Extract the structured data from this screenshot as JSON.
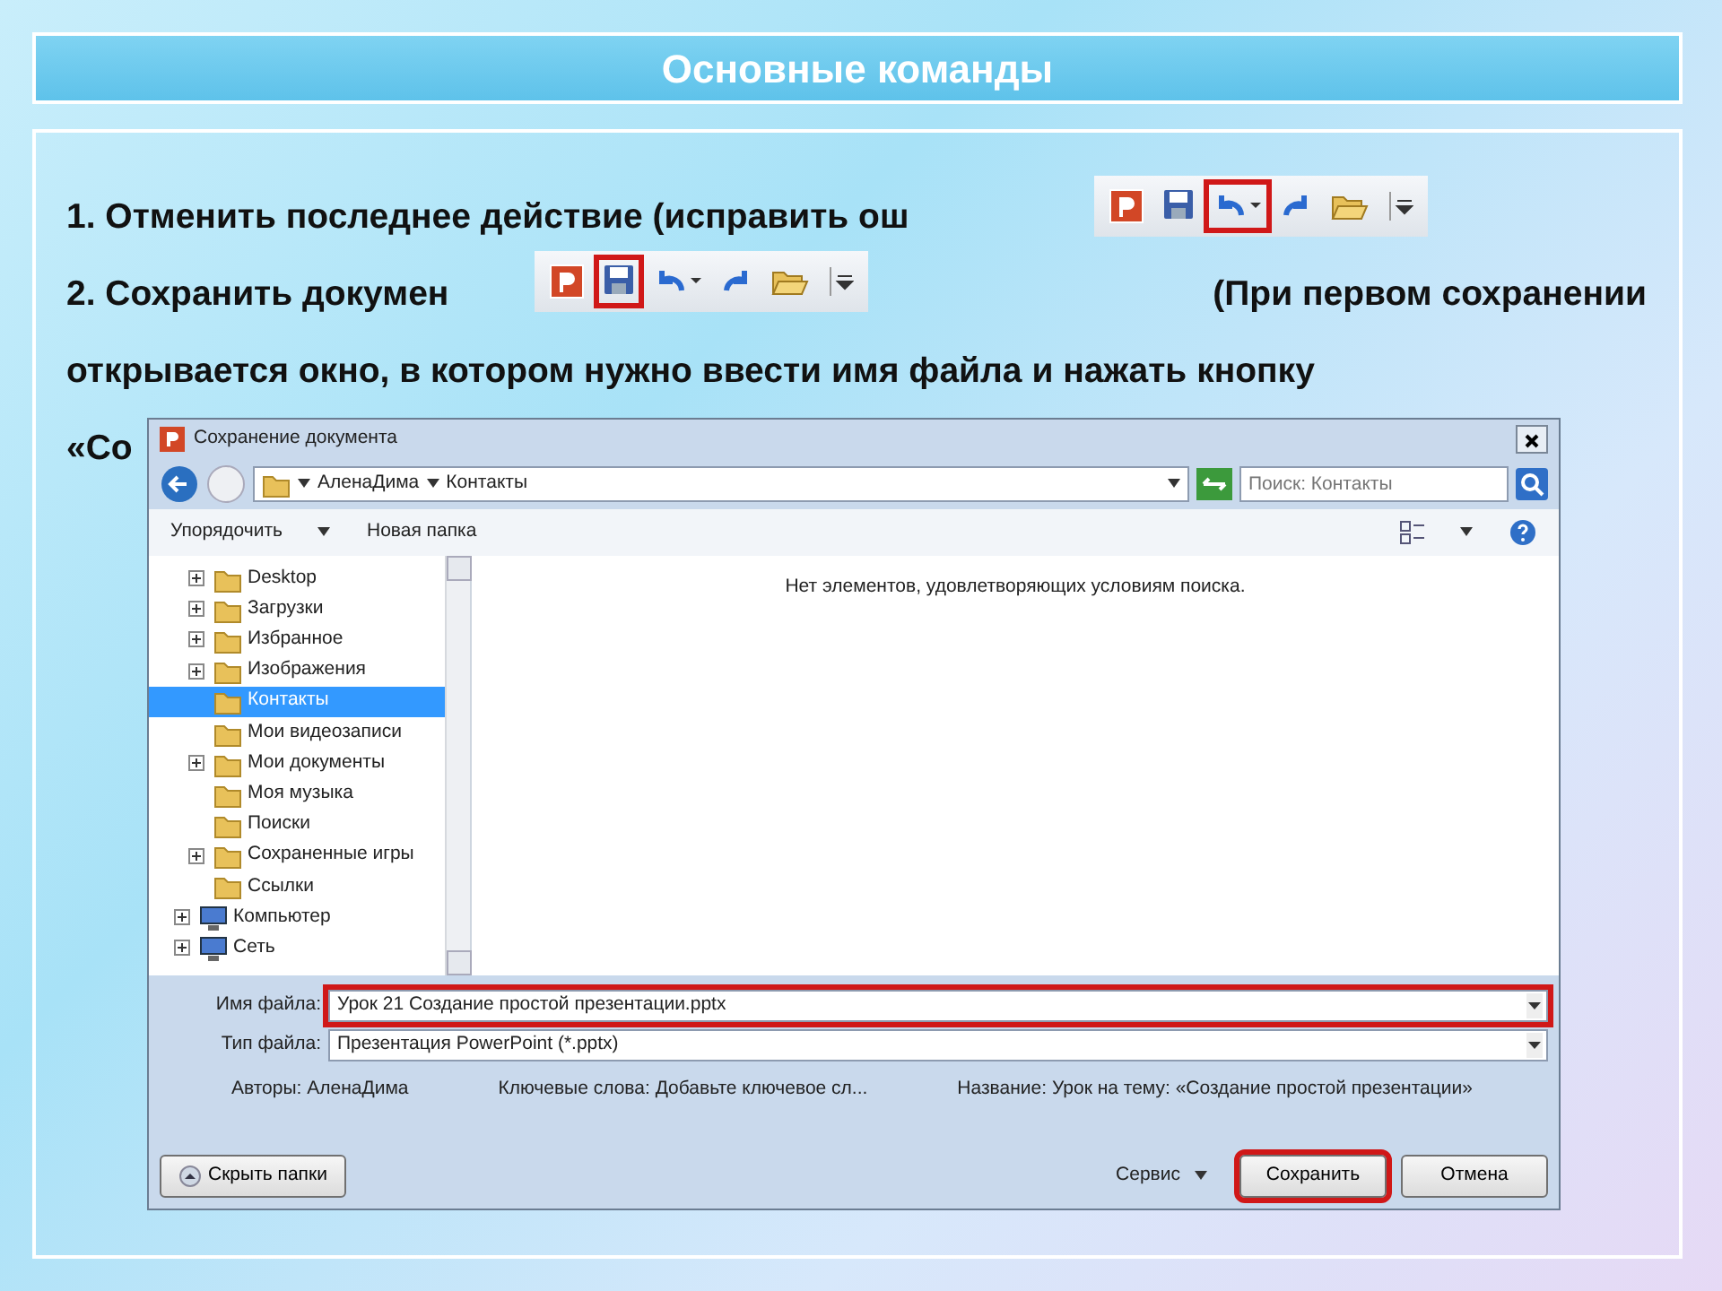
{
  "slide_title": "Основные команды",
  "lines": [
    {
      "left": "1. Отменить последнее действие (исправить ош"
    },
    {
      "left": "2. Сохранить докумен",
      "right": "(При первом сохранении"
    },
    {
      "left": "открывается окно, в котором нужно ввести имя файла и нажать кнопку"
    },
    {
      "left": "«Со"
    }
  ],
  "toolbars": [
    {
      "buttons": [
        {
          "kind": "app",
          "highlighted": false
        },
        {
          "kind": "save",
          "highlighted": false
        },
        {
          "kind": "undo",
          "highlighted": true
        },
        {
          "kind": "redo",
          "highlighted": false
        },
        {
          "kind": "open",
          "highlighted": false
        },
        {
          "kind": "customize",
          "highlighted": false
        }
      ]
    },
    {
      "buttons": [
        {
          "kind": "app",
          "highlighted": false
        },
        {
          "kind": "save",
          "highlighted": true
        },
        {
          "kind": "undo",
          "highlighted": false
        },
        {
          "kind": "redo",
          "highlighted": false
        },
        {
          "kind": "open",
          "highlighted": false
        },
        {
          "kind": "customize",
          "highlighted": false
        }
      ]
    }
  ],
  "dialog": {
    "title": "Сохранение документа",
    "breadcrumb": [
      "АленаДима",
      "Контакты"
    ],
    "search": {
      "placeholder": "Поиск: Контакты"
    },
    "toolbar": [
      "Упорядочить",
      "Новая папка"
    ],
    "tree": {
      "user_folder_items": [
        {
          "label": "Desktop",
          "expandable": true,
          "selected": false
        },
        {
          "label": "Загрузки",
          "expandable": true,
          "selected": false
        },
        {
          "label": "Избранное",
          "expandable": true,
          "selected": false
        },
        {
          "label": "Изображения",
          "expandable": true,
          "selected": false
        },
        {
          "label": "Контакты",
          "expandable": false,
          "selected": true
        },
        {
          "label": "Мои видеозаписи",
          "expandable": false,
          "selected": false
        },
        {
          "label": "Мои документы",
          "expandable": true,
          "selected": false
        },
        {
          "label": "Моя музыка",
          "expandable": false,
          "selected": false
        },
        {
          "label": "Поиски",
          "expandable": false,
          "selected": false
        },
        {
          "label": "Сохраненные игры",
          "expandable": true,
          "selected": false
        },
        {
          "label": "Ссылки",
          "expandable": false,
          "selected": false
        }
      ],
      "root_items": [
        {
          "label": "Компьютер",
          "expandable": true,
          "selected": false
        },
        {
          "label": "Сеть",
          "expandable": true,
          "selected": false
        }
      ]
    },
    "empty_message": "Нет элементов, удовлетворяющих условиям поиска.",
    "file_name": {
      "label": "Имя файла:",
      "value": "Урок 21 Создание простой презентации.pptx",
      "highlighted": true
    },
    "file_type": {
      "label": "Тип файла:",
      "value": "Презентация PowerPoint (*.pptx)"
    },
    "meta": [
      {
        "label": "Авторы:",
        "value": "АленаДима"
      },
      {
        "label": "Ключевые слова:",
        "value": "Добавьте ключевое сл..."
      },
      {
        "label": "Название:",
        "value": "Урок на тему: «Создание простой презентации»"
      }
    ],
    "hide_folders": "Скрыть папки",
    "service": "Сервис",
    "buttons": [
      {
        "label": "Сохранить",
        "highlighted": true
      },
      {
        "label": "Отмена",
        "highlighted": false
      }
    ]
  }
}
